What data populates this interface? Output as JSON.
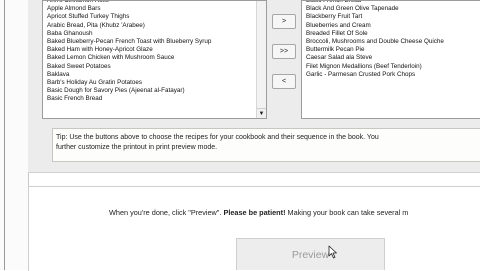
{
  "left_list": {
    "items": [
      "Ann's Cinnamon Rolls",
      "Apple Almond Bars",
      "Apricot Stuffed Turkey Thighs",
      "Arabic Bread, Pita (Khubz 'Arabee)",
      "Baba Ghanoush",
      "Baked Blueberry-Pecan French Toast with Blueberry Syrup",
      "Baked Ham with Honey-Apricot Glaze",
      "Baked Lemon Chicken with Mushroom Sauce",
      "Baked Sweet Potatoes",
      "Baklava",
      "Barb's Holiday Au Gratin Potatoes",
      "Basic Dough for Savory Pies (Ajeenat al-Fatayar)",
      "Basic French Bread"
    ]
  },
  "right_list": {
    "items": [
      "Basic French Bread",
      "Black And Green Olive Tapenade",
      "Blackberry Fruit Tart",
      "Blueberries and Cream",
      "Breaded Fillet Of Sole",
      "Broccoli, Mushrooms and Double Cheese Quiche",
      "Buttermilk Pecan Pie",
      "Caesar Salad ala Steve",
      "Filet Mignon Medallions (Beef Tenderloin)",
      "Garlic - Parmesan Crusted Pork Chops"
    ]
  },
  "buttons": {
    "add_one": ">",
    "add_all": ">>",
    "remove_one": "<",
    "preview": "Preview"
  },
  "tip": {
    "line1": "Tip: Use the buttons above to choose the recipes for your cookbook and their sequence in the book. You",
    "line2": "further customize the printout in print preview mode."
  },
  "hint": {
    "before": "When you're done, click \"Preview\". ",
    "bold": "Please be patient!",
    "after": "  Making your book can take several m"
  },
  "icons": {
    "scroll_down": "chevron-down-icon",
    "cursor": "mouse-pointer-icon"
  }
}
